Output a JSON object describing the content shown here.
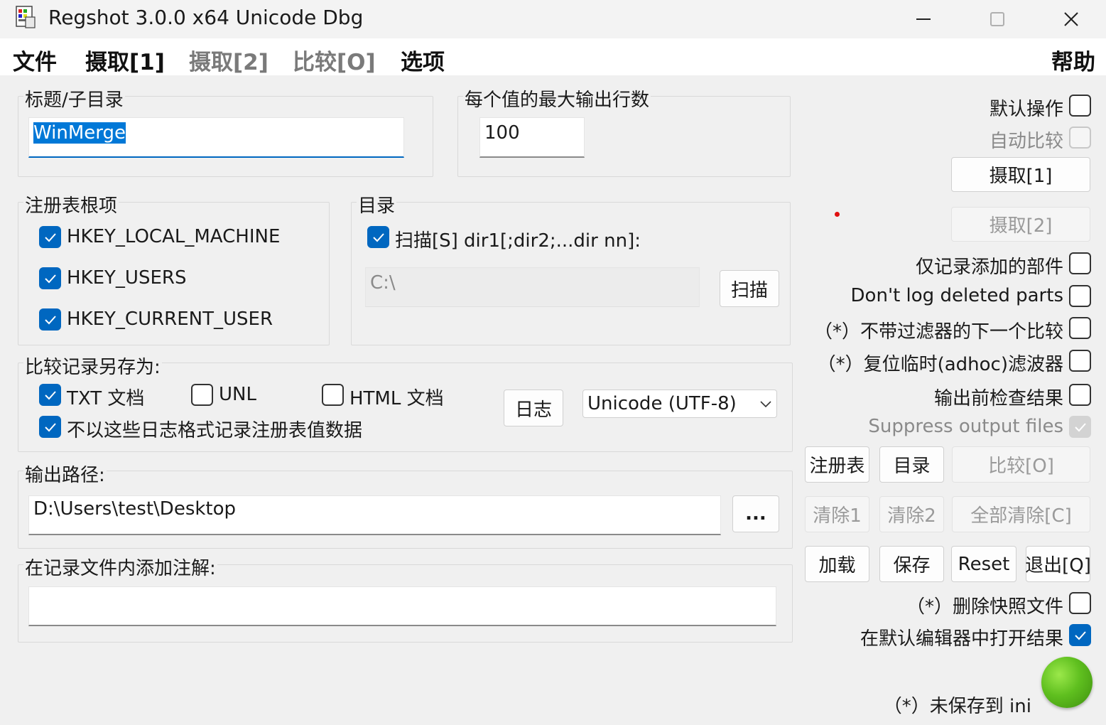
{
  "window": {
    "title": "Regshot 3.0.0 x64 Unicode Dbg",
    "minimize": "—",
    "maximize": "☐",
    "close": "✕"
  },
  "menu": {
    "file": "文件",
    "shot1": "摄取[1]",
    "shot2": "摄取[2]",
    "compare": "比较[O]",
    "options": "选项",
    "help": "帮助"
  },
  "title_group": {
    "label": "标题/子目录",
    "value": "WinMerge"
  },
  "max_lines_group": {
    "label": "每个值的最大输出行数",
    "value": "100"
  },
  "registry_group": {
    "label": "注册表根项",
    "items": [
      {
        "label": "HKEY_LOCAL_MACHINE",
        "checked": true
      },
      {
        "label": "HKEY_USERS",
        "checked": true
      },
      {
        "label": "HKEY_CURRENT_USER",
        "checked": true
      }
    ]
  },
  "dir_group": {
    "label": "目录",
    "scan_label": "扫描[S] dir1[;dir2;...dir nn]:",
    "scan_checked": true,
    "path_value": "C:\\",
    "scan_button": "扫描"
  },
  "save_as_group": {
    "label": "比较记录另存为:",
    "txt_label": "TXT 文档",
    "txt_checked": true,
    "unl_label": "UNL",
    "unl_checked": false,
    "html_label": "HTML 文档",
    "html_checked": false,
    "noreg_label": "不以这些日志格式记录注册表值数据",
    "noreg_checked": true,
    "log_button": "日志",
    "encoding": "Unicode (UTF-8)"
  },
  "output_group": {
    "label": "输出路径:",
    "value": "D:\\Users\\test\\Desktop",
    "browse_button": "..."
  },
  "comment_group": {
    "label": "在记录文件内添加注解:",
    "value": ""
  },
  "right_panel": {
    "default_action": "默认操作",
    "auto_compare": "自动比较",
    "shot1_button": "摄取[1]",
    "shot2_button": "摄取[2]",
    "only_added": "仅记录添加的部件",
    "dont_log_deleted": "Don't log deleted parts",
    "no_filter_next": "（*）不带过滤器的下一个比较",
    "reset_adhoc": "（*）复位临时(adhoc)滤波器",
    "check_before_output": "输出前检查结果",
    "suppress_output": "Suppress output files",
    "registry_button": "注册表",
    "directory_button": "目录",
    "compare_button": "比较[O]",
    "clear1_button": "清除1",
    "clear2_button": "清除2",
    "clear_all_button": "全部清除[C]",
    "load_button": "加载",
    "save_button": "保存",
    "reset_button": "Reset",
    "quit_button": "退出[Q]",
    "delete_snapshot": "（*）删除快照文件",
    "open_in_editor": "在默认编辑器中打开结果",
    "not_saved_ini": "（*）未保存到 ini"
  },
  "colors": {
    "accent": "#0067c0",
    "status_led": "#5fbf1f"
  }
}
